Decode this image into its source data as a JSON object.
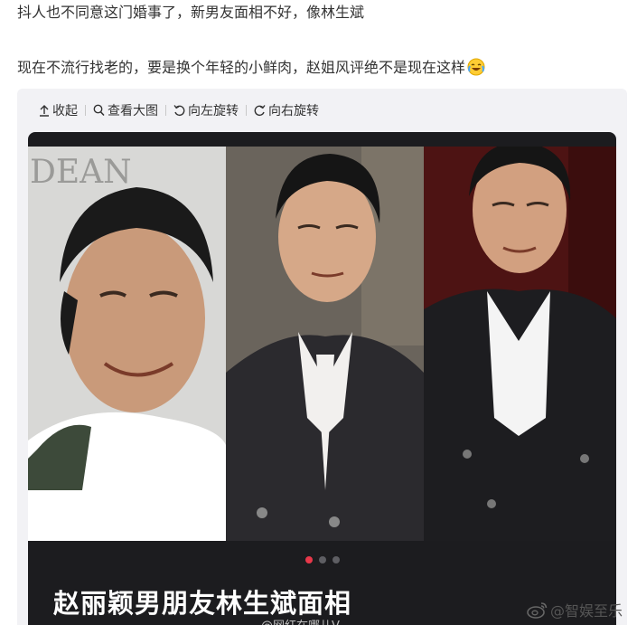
{
  "post": {
    "line1": "抖人也不同意这门婚事了，新男友面相不好，像林生斌",
    "line2": "现在不流行找老的，要是换个年轻的小鲜肉，赵姐风评绝不是现在这样",
    "line2_emoji": "laugh-cry-emoji"
  },
  "toolbar": {
    "collapse": "收起",
    "view_large": "查看大图",
    "rotate_left": "向左旋转",
    "rotate_right": "向右旋转"
  },
  "image": {
    "caption": "赵丽颖男朋友林生斌面相",
    "inner_watermark": "@网红在哪儿V",
    "photo1_bg_text": "DEAN",
    "pagination": {
      "current": 1,
      "total": 3
    }
  },
  "watermark": {
    "text": "@智娱至乐"
  },
  "colors": {
    "accent": "#e8384a",
    "viewer_bg": "#1c1c1f",
    "card_bg": "#f2f2f5"
  }
}
